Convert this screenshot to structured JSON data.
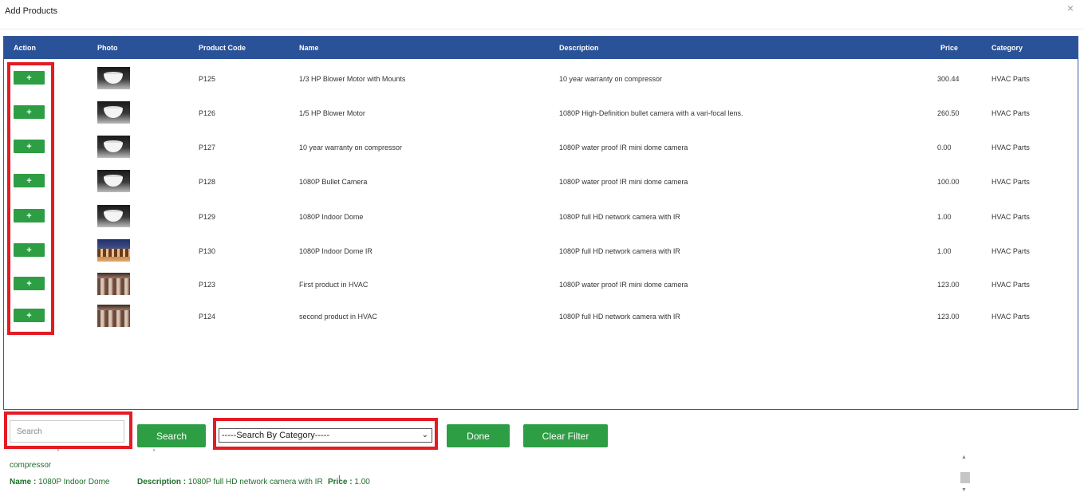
{
  "dialog": {
    "title": "Add Products",
    "close": "×"
  },
  "table": {
    "headers": {
      "action": "Action",
      "photo": "Photo",
      "product_code": "Product Code",
      "name": "Name",
      "description": "Description",
      "price": "Price",
      "category": "Category"
    },
    "add_label": "+",
    "rows": [
      {
        "code": "P125",
        "name": "1/3 HP Blower Motor with Mounts",
        "description": "10 year warranty on compressor",
        "price": "300.44",
        "category": "HVAC Parts",
        "photo": "bowl-photo"
      },
      {
        "code": "P126",
        "name": "1/5 HP Blower Motor",
        "description": "1080P High-Definition bullet camera with a vari-focal lens.",
        "price": "260.50",
        "category": "HVAC Parts",
        "photo": "bowl-photo"
      },
      {
        "code": "P127",
        "name": "10 year warranty on compressor",
        "description": "1080P water proof IR mini dome camera",
        "price": "0.00",
        "category": "HVAC Parts",
        "photo": "bowl-photo"
      },
      {
        "code": "P128",
        "name": "1080P Bullet Camera",
        "description": "1080P water proof IR mini dome camera",
        "price": "100.00",
        "category": "HVAC Parts",
        "photo": "bowl-photo"
      },
      {
        "code": "P129",
        "name": "1080P Indoor Dome",
        "description": "1080P full HD network camera with IR",
        "price": "1.00",
        "category": "HVAC Parts",
        "photo": "bowl-photo"
      },
      {
        "code": "P130",
        "name": "1080P Indoor Dome IR",
        "description": "1080P full HD network camera with IR",
        "price": "1.00",
        "category": "HVAC Parts",
        "photo": "scene-photo"
      },
      {
        "code": "P123",
        "name": "First product in HVAC",
        "description": "1080P water proof IR mini dome camera",
        "price": "123.00",
        "category": "HVAC Parts",
        "photo": "columns-photo"
      },
      {
        "code": "P124",
        "name": "second product in HVAC",
        "description": "1080P full HD network camera with IR",
        "price": "123.00",
        "category": "HVAC Parts",
        "photo": "columns-photo"
      }
    ]
  },
  "filters": {
    "search_placeholder": "Search",
    "search_button": "Search",
    "category_selected": "-----Search By Category-----",
    "done_button": "Done",
    "clear_button": "Clear Filter"
  },
  "preview": {
    "line1": "compressor",
    "name_label": "Name :",
    "name_value": "1080P Indoor Dome",
    "description_label": "Description :",
    "description_value": "1080P full HD network camera with IR",
    "price_label": "Price :",
    "price_value": "1.00"
  },
  "colors": {
    "header_bg": "#2a5298",
    "button_green": "#2e9e45",
    "highlight_red": "#e51b24",
    "preview_text": "#1f6f2a"
  }
}
